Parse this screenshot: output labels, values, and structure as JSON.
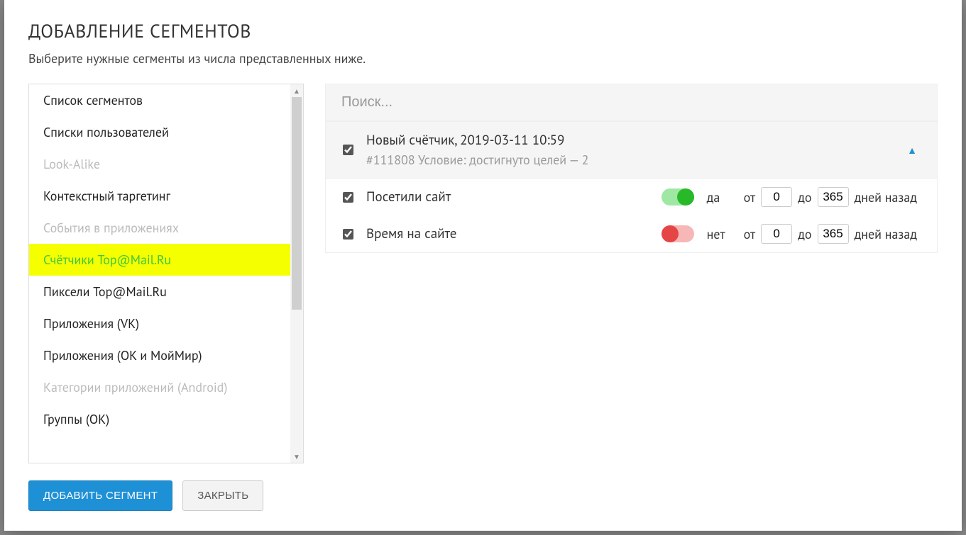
{
  "modal": {
    "title": "ДОБАВЛЕНИЕ СЕГМЕНТОВ",
    "subtitle": "Выберите нужные сегменты из числа представленных ниже."
  },
  "sidebar": {
    "items": [
      {
        "label": "Список сегментов",
        "state": "normal"
      },
      {
        "label": "Списки пользователей",
        "state": "normal"
      },
      {
        "label": "Look-Alike",
        "state": "disabled"
      },
      {
        "label": "Контекстный таргетинг",
        "state": "normal"
      },
      {
        "label": "События в приложениях",
        "state": "disabled"
      },
      {
        "label": "Счётчики Top@Mail.Ru",
        "state": "active"
      },
      {
        "label": "Пиксели Top@Mail.Ru",
        "state": "normal"
      },
      {
        "label": "Приложения (VK)",
        "state": "normal"
      },
      {
        "label": "Приложения (OK и МойМир)",
        "state": "normal"
      },
      {
        "label": "Категории приложений (Android)",
        "state": "disabled"
      },
      {
        "label": "Группы (ОК)",
        "state": "normal"
      }
    ]
  },
  "search": {
    "placeholder": "Поиск..."
  },
  "counter": {
    "checked": true,
    "title": "Новый счётчик, 2019-03-11 10:59",
    "subtitle": "#111808 Условие: достигнуто целей — 2",
    "expanded": true
  },
  "conditions": [
    {
      "key": "visited",
      "checked": true,
      "label": "Посетили сайт",
      "toggle_on": true,
      "toggle_text": "да",
      "from_label": "от",
      "from_value": "0",
      "to_label": "до",
      "to_value": "365",
      "suffix": "дней назад"
    },
    {
      "key": "time_on_site",
      "checked": true,
      "label": "Время на сайте",
      "toggle_on": false,
      "toggle_text": "нет",
      "from_label": "от",
      "from_value": "0",
      "to_label": "до",
      "to_value": "365",
      "suffix": "дней назад"
    }
  ],
  "footer": {
    "add_label": "ДОБАВИТЬ СЕГМЕНТ",
    "close_label": "ЗАКРЫТЬ"
  }
}
